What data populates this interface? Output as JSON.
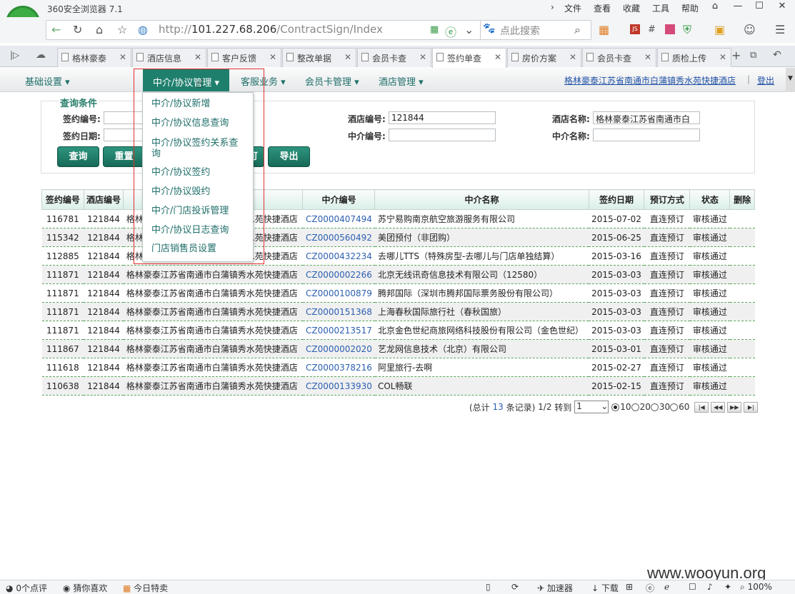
{
  "browser": {
    "app_title": "360安全浏览器 7.1",
    "menu": [
      "文件",
      "查看",
      "收藏",
      "工具",
      "帮助"
    ],
    "url_prefix": "http://",
    "url_host": "101.227.68.206",
    "url_path": "/ContractSign/Index",
    "search_placeholder": "点此搜索",
    "tabs": [
      "格林豪泰",
      "酒店信息",
      "客户反馈",
      "整改单据",
      "会员卡查",
      "签约单查",
      "房价方案",
      "会员卡查",
      "质检上传"
    ],
    "active_tab": 5
  },
  "menu": {
    "items": [
      "基础设置",
      "中介/协议管理",
      "客服业务",
      "会员卡管理",
      "酒店管理"
    ],
    "hotel_link": "格林豪泰江苏省南通市白蒲镇秀水苑快捷酒店",
    "logout": "登出"
  },
  "dropdown": {
    "items": [
      "中介/协议新增",
      "中介/协议信息查询",
      "中介/协议签约关系查询",
      "中介/协议签约",
      "中介/协议毁约",
      "中介/门店投诉管理",
      "中介/协议日志查询",
      "门店销售员设置"
    ]
  },
  "query": {
    "title": "查询条件",
    "sign_no_label": "签约编号:",
    "sign_date_label": "签约日期:",
    "hotel_no_label": "酒店编号:",
    "hotel_no_value": "121844",
    "agent_no_label": "中介编号:",
    "hotel_name_label": "酒店名称:",
    "hotel_name_value": "格林豪泰江苏省南通市白",
    "agent_name_label": "中介名称:",
    "btn_query": "查询",
    "btn_reset": "重置",
    "btn_hidden": "可",
    "btn_export": "导出"
  },
  "table": {
    "headers": [
      "签约编号",
      "酒店编号",
      "",
      "中介编号",
      "中介名称",
      "签约日期",
      "预订方式",
      "状态",
      "删除"
    ],
    "rows": [
      [
        "116781",
        "121844",
        "格林豪泰江苏省南通市白蒲镇秀水苑快捷酒店",
        "CZ0000407494",
        "苏宁易购南京航空旅游服务有限公司",
        "2015-07-02",
        "直连预订",
        "审核通过"
      ],
      [
        "115342",
        "121844",
        "格林豪泰江苏省南通市白蒲镇秀水苑快捷酒店",
        "CZ0000560492",
        "美团预付（非团购）",
        "2015-06-25",
        "直连预订",
        "审核通过"
      ],
      [
        "112885",
        "121844",
        "格林豪泰江苏省南通市白蒲镇秀水苑快捷酒店",
        "CZ0000432234",
        "去哪儿TTS（特殊房型-去哪儿与门店单独结算）",
        "2015-03-16",
        "直连预订",
        "审核通过"
      ],
      [
        "111871",
        "121844",
        "格林豪泰江苏省南通市白蒲镇秀水苑快捷酒店",
        "CZ0000002266",
        "北京无线讯奇信息技术有限公司（12580）",
        "2015-03-03",
        "直连预订",
        "审核通过"
      ],
      [
        "111871",
        "121844",
        "格林豪泰江苏省南通市白蒲镇秀水苑快捷酒店",
        "CZ0000100879",
        "腾邦国际（深圳市腾邦国际票务股份有限公司）",
        "2015-03-03",
        "直连预订",
        "审核通过"
      ],
      [
        "111871",
        "121844",
        "格林豪泰江苏省南通市白蒲镇秀水苑快捷酒店",
        "CZ0000151368",
        "上海春秋国际旅行社（春秋国旅）",
        "2015-03-03",
        "直连预订",
        "审核通过"
      ],
      [
        "111871",
        "121844",
        "格林豪泰江苏省南通市白蒲镇秀水苑快捷酒店",
        "CZ0000213517",
        "北京金色世纪商旅网络科技股份有限公司（金色世纪）",
        "2015-03-03",
        "直连预订",
        "审核通过"
      ],
      [
        "111867",
        "121844",
        "格林豪泰江苏省南通市白蒲镇秀水苑快捷酒店",
        "CZ0000002020",
        "艺龙网信息技术（北京）有限公司",
        "2015-03-01",
        "直连预订",
        "审核通过"
      ],
      [
        "111618",
        "121844",
        "格林豪泰江苏省南通市白蒲镇秀水苑快捷酒店",
        "CZ0000378216",
        "阿里旅行-去啊",
        "2015-02-27",
        "直连预订",
        "审核通过"
      ],
      [
        "110638",
        "121844",
        "格林豪泰江苏省南通市白蒲镇秀水苑快捷酒店",
        "CZ0000133930",
        "COL畅联",
        "2015-02-15",
        "直连预订",
        "审核通过"
      ]
    ]
  },
  "pager": {
    "total_prefix": "(总计",
    "total": "13",
    "total_suffix": "条记录)",
    "page": "1/2",
    "goto": "转到",
    "page_select": "1",
    "sizes": [
      "10",
      "20",
      "30",
      "60"
    ]
  },
  "status": {
    "comments": "0个点评",
    "guess": "猜你喜欢",
    "deals": "今日特卖",
    "accelerator": "加速器",
    "download": "下载",
    "zoom": "100%"
  },
  "watermark": "www.wooyun.org"
}
